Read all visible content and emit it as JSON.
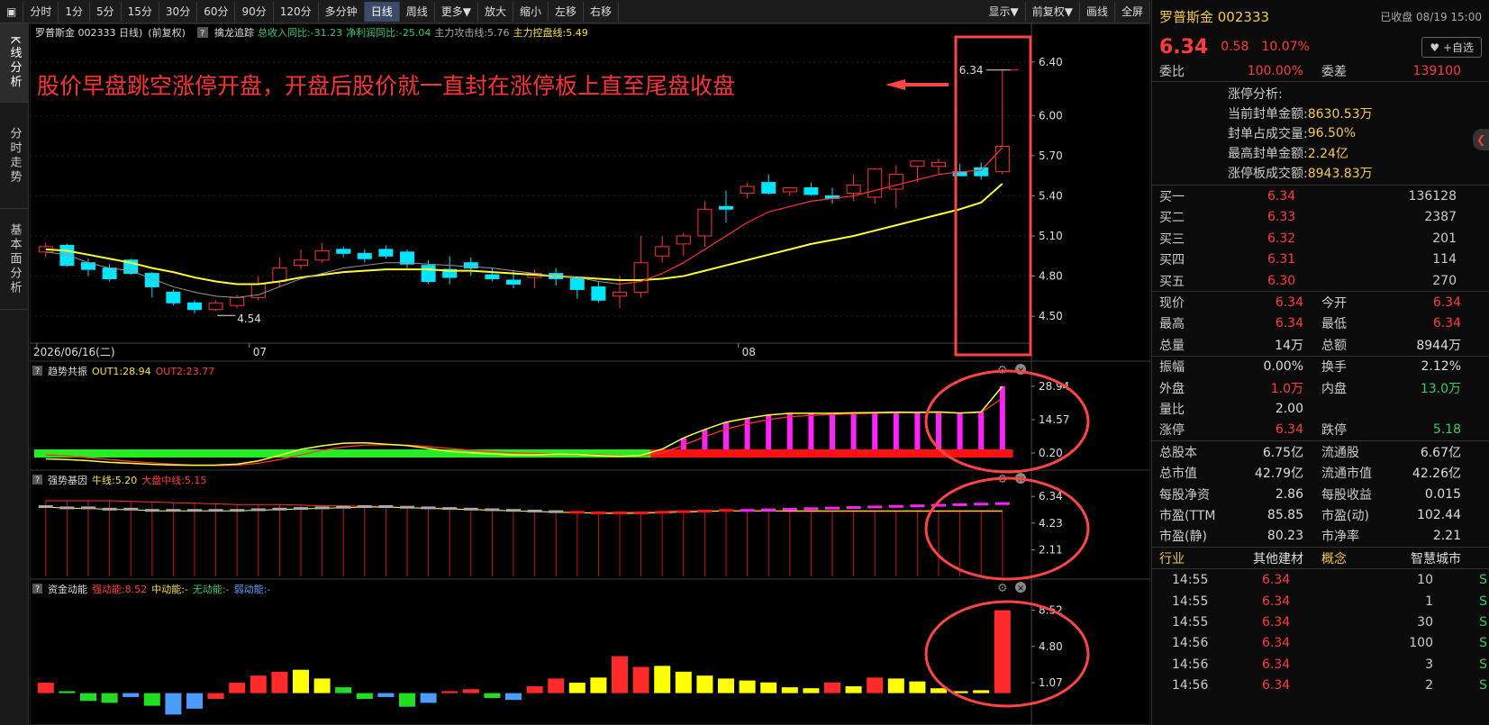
{
  "toolbar": {
    "items": [
      "分时",
      "1分",
      "5分",
      "15分",
      "30分",
      "60分",
      "90分",
      "120分",
      "多分钟",
      "日线",
      "周线",
      "更多▼",
      "放大",
      "缩小",
      "左移",
      "右移"
    ],
    "active": "日线",
    "right": [
      "显示▼",
      "前复权▼",
      "画线",
      "全屏"
    ]
  },
  "sidetabs": [
    "K线分析",
    "分时走势",
    "基本面分析"
  ],
  "chart": {
    "main": {
      "title": "罗普斯金 002333 日线)",
      "mode": "(前复权)",
      "indicator": "擒龙追踪",
      "legend": [
        {
          "text": "总收入同比:-31.23",
          "color": "#33cc66"
        },
        {
          "text": "净利润同比:-25.04",
          "color": "#33cc66"
        },
        {
          "text": "主力攻击线:5.76",
          "color": "#aaaaaa"
        },
        {
          "text": "主力控盘线:5.49",
          "color": "#f7e23c"
        }
      ],
      "yticks": [
        "6.40",
        "6.00",
        "5.70",
        "5.40",
        "5.10",
        "4.80",
        "4.50"
      ],
      "ytick_values": [
        6.4,
        6.0,
        5.7,
        5.4,
        5.1,
        4.8,
        4.5
      ],
      "ylim": [
        4.4,
        6.5
      ],
      "date_labels": [
        {
          "idx": 0,
          "text": "2026/06/16(二)"
        },
        {
          "idx": 10,
          "text": "07"
        },
        {
          "idx": 33,
          "text": "08"
        }
      ],
      "low_label": "4.54",
      "high_label": "6.34",
      "annotation": "股价早盘跳空涨停开盘，开盘后股价就一直封在涨停板上直至尾盘收盘"
    },
    "p1": {
      "name": "趋势共振",
      "legend": [
        {
          "text": "OUT1:28.94",
          "color": "#f7e23c"
        },
        {
          "text": "OUT2:23.77",
          "color": "#ff3b3b"
        }
      ],
      "yticks": [
        "28.94",
        "14.57",
        "0.20"
      ],
      "ytick_values": [
        28.94,
        14.57,
        0.2
      ],
      "ylim": [
        -6,
        32
      ]
    },
    "p2": {
      "name": "强势基因",
      "legend": [
        {
          "text": "牛线:5.20",
          "color": "#f7e23c"
        },
        {
          "text": "大盘中线:5.15",
          "color": "#ff3b3b"
        }
      ],
      "yticks": [
        "6.34",
        "4.23",
        "2.11"
      ],
      "ytick_values": [
        6.34,
        4.23,
        2.11
      ],
      "ylim": [
        0,
        7
      ]
    },
    "p3": {
      "name": "资金动能",
      "legend": [
        {
          "text": "强动能:8.52",
          "color": "#ff3b3b"
        },
        {
          "text": "中动能:-",
          "color": "#f7e23c"
        },
        {
          "text": "无动能:-",
          "color": "#33cc66"
        },
        {
          "text": "弱动能:-",
          "color": "#5aa0ff"
        }
      ],
      "yticks": [
        "8.52",
        "4.80",
        "1.07"
      ],
      "ytick_values": [
        8.52,
        4.8,
        1.07
      ],
      "ylim": [
        -3,
        9.5
      ]
    }
  },
  "chart_data": {
    "type": "candlestick",
    "count": 46,
    "open": [
      4.98,
      5.03,
      4.9,
      4.86,
      4.92,
      4.82,
      4.68,
      4.6,
      4.55,
      4.58,
      4.64,
      4.76,
      4.88,
      4.92,
      5.0,
      4.97,
      5.0,
      4.98,
      4.88,
      4.85,
      4.9,
      4.81,
      4.77,
      4.79,
      4.82,
      4.78,
      4.72,
      4.65,
      4.68,
      4.95,
      5.04,
      5.1,
      5.32,
      5.42,
      5.5,
      5.43,
      5.46,
      5.4,
      5.42,
      5.39,
      5.45,
      5.62,
      5.62,
      5.58,
      5.61,
      5.58
    ],
    "high": [
      5.05,
      5.04,
      4.93,
      4.89,
      4.93,
      4.83,
      4.7,
      4.62,
      4.62,
      4.66,
      4.8,
      4.94,
      5.0,
      5.05,
      5.02,
      5.0,
      5.03,
      5.0,
      4.92,
      4.95,
      4.94,
      4.86,
      4.84,
      4.85,
      4.86,
      4.8,
      4.76,
      4.8,
      5.1,
      5.1,
      5.12,
      5.36,
      5.44,
      5.5,
      5.56,
      5.46,
      5.5,
      5.46,
      5.56,
      5.61,
      5.63,
      5.65,
      5.68,
      5.64,
      5.65,
      6.34
    ],
    "low": [
      4.94,
      4.87,
      4.8,
      4.76,
      4.81,
      4.64,
      4.58,
      4.52,
      4.54,
      4.56,
      4.62,
      4.72,
      4.85,
      4.9,
      4.94,
      4.9,
      4.93,
      4.86,
      4.74,
      4.74,
      4.8,
      4.76,
      4.71,
      4.71,
      4.73,
      4.63,
      4.6,
      4.56,
      4.64,
      4.9,
      4.95,
      5.02,
      5.2,
      5.38,
      5.41,
      5.4,
      5.4,
      5.34,
      5.36,
      5.34,
      5.31,
      5.5,
      5.56,
      5.56,
      5.52,
      5.56
    ],
    "close": [
      5.02,
      4.88,
      4.85,
      4.78,
      4.82,
      4.72,
      4.6,
      4.55,
      4.6,
      4.64,
      4.74,
      4.86,
      4.92,
      4.99,
      4.97,
      4.93,
      4.95,
      4.89,
      4.76,
      4.79,
      4.86,
      4.78,
      4.74,
      4.82,
      4.78,
      4.7,
      4.62,
      4.68,
      4.9,
      5.02,
      5.1,
      5.3,
      5.3,
      5.47,
      5.42,
      5.46,
      5.41,
      5.38,
      5.48,
      5.6,
      5.56,
      5.66,
      5.65,
      5.55,
      5.55,
      5.77
    ],
    "ma_attack": [
      4.98,
      4.96,
      4.9,
      4.86,
      4.84,
      4.78,
      4.72,
      4.68,
      4.65,
      4.64,
      4.66,
      4.72,
      4.78,
      4.82,
      4.86,
      4.88,
      4.9,
      4.9,
      4.89,
      4.88,
      4.87,
      4.86,
      4.84,
      4.82,
      4.8,
      4.79,
      4.76,
      4.74,
      4.76,
      4.82,
      4.9,
      5.0,
      5.1,
      5.2,
      5.28,
      5.32,
      5.36,
      5.38,
      5.4,
      5.44,
      5.48,
      5.52,
      5.56,
      5.58,
      5.59,
      5.76
    ],
    "ma_control": [
      5.0,
      4.99,
      4.96,
      4.93,
      4.9,
      4.86,
      4.83,
      4.79,
      4.76,
      4.74,
      4.74,
      4.76,
      4.79,
      4.81,
      4.83,
      4.84,
      4.85,
      4.85,
      4.85,
      4.84,
      4.84,
      4.83,
      4.82,
      4.81,
      4.8,
      4.79,
      4.78,
      4.77,
      4.77,
      4.78,
      4.8,
      4.84,
      4.88,
      4.92,
      4.96,
      5.0,
      5.04,
      5.07,
      5.1,
      5.14,
      5.18,
      5.22,
      5.26,
      5.3,
      5.35,
      5.49
    ],
    "trend_out1": [
      -2.3,
      -2.6,
      -3.1,
      -3.8,
      -4.2,
      -4.7,
      -5.0,
      -5.1,
      -5.0,
      -4.6,
      -3.2,
      -0.8,
      1.8,
      3.3,
      4.4,
      4.6,
      4.0,
      3.4,
      2.2,
      0.9,
      0.3,
      -0.2,
      -0.6,
      -0.6,
      -0.3,
      -0.4,
      -0.9,
      -1.2,
      -0.8,
      1.9,
      6.7,
      10.3,
      13.5,
      15.2,
      16.6,
      17.3,
      17.3,
      17.3,
      17.5,
      17.6,
      17.8,
      17.7,
      17.9,
      17.4,
      17.9,
      28.94
    ],
    "trend_out2": [
      -0.6,
      -1.0,
      -1.8,
      -2.6,
      -3.4,
      -4.0,
      -4.6,
      -5.0,
      -5.2,
      -5.0,
      -4.2,
      -2.6,
      -0.6,
      1.4,
      2.8,
      3.6,
      3.8,
      3.6,
      3.0,
      2.2,
      1.4,
      0.8,
      0.3,
      0.0,
      -0.2,
      -0.3,
      -0.6,
      -0.9,
      -1.0,
      0.2,
      3.6,
      7.2,
      10.5,
      12.8,
      14.6,
      15.8,
      16.4,
      16.8,
      17.1,
      17.3,
      17.5,
      17.6,
      17.7,
      17.5,
      17.6,
      23.77
    ],
    "trend_state": [
      "g",
      "g",
      "g",
      "g",
      "g",
      "g",
      "g",
      "g",
      "g",
      "g",
      "g",
      "g",
      "g",
      "g",
      "g",
      "g",
      "g",
      "g",
      "g",
      "g",
      "g",
      "g",
      "g",
      "g",
      "g",
      "g",
      "g",
      "g",
      "g",
      "r",
      "r",
      "r",
      "r",
      "r",
      "r",
      "r",
      "r",
      "r",
      "r",
      "r",
      "r",
      "r",
      "r",
      "r",
      "r",
      "r"
    ],
    "gene_bull": [
      5.5,
      5.4,
      5.4,
      5.3,
      5.3,
      5.2,
      5.2,
      5.2,
      5.2,
      5.2,
      5.25,
      5.3,
      5.35,
      5.4,
      5.45,
      5.5,
      5.5,
      5.45,
      5.4,
      5.35,
      5.3,
      5.25,
      5.2,
      5.15,
      5.1,
      5.05,
      5.0,
      5.0,
      5.0,
      5.05,
      5.1,
      5.15,
      5.2,
      5.2,
      5.2,
      5.2,
      5.2,
      5.2,
      5.2,
      5.2,
      5.2,
      5.2,
      5.2,
      5.2,
      5.2,
      5.2
    ],
    "gene_mid": [
      6.0,
      6.0,
      6.0,
      6.0,
      5.95,
      5.9,
      5.85,
      5.8,
      5.75,
      5.7,
      5.7,
      5.7,
      5.65,
      5.6,
      5.6,
      5.55,
      5.5,
      5.45,
      5.4,
      5.35,
      5.3,
      5.25,
      5.2,
      5.15,
      5.1,
      5.05,
      5.05,
      5.05,
      5.1,
      5.15,
      5.2,
      5.2,
      5.2,
      5.2,
      5.2,
      5.15,
      5.15,
      5.15,
      5.15,
      5.15,
      5.15,
      5.15,
      5.15,
      5.15,
      5.15,
      5.15
    ],
    "gene_dash_color": [
      "g",
      "g",
      "g",
      "g",
      "g",
      "g",
      "g",
      "g",
      "g",
      "g",
      "g",
      "g",
      "g",
      "g",
      "g",
      "g",
      "g",
      "g",
      "g",
      "g",
      "g",
      "g",
      "g",
      "g",
      "g",
      "r",
      "r",
      "r",
      "r",
      "r",
      "r",
      "r",
      "r",
      "m",
      "m",
      "m",
      "m",
      "m",
      "m",
      "m",
      "m",
      "m",
      "m",
      "m",
      "m",
      "m"
    ],
    "energy": [
      1.07,
      0.2,
      -0.8,
      -1.0,
      -0.4,
      -1.3,
      -2.2,
      -1.6,
      -0.6,
      1.07,
      1.8,
      2.2,
      2.4,
      1.5,
      0.6,
      -0.6,
      -0.4,
      -1.4,
      -1.0,
      0.2,
      0.4,
      -0.5,
      -0.7,
      0.7,
      1.5,
      1.07,
      1.6,
      3.8,
      2.7,
      2.8,
      2.2,
      1.8,
      1.5,
      1.3,
      1.1,
      0.6,
      0.5,
      1.1,
      0.7,
      1.6,
      1.5,
      1.2,
      0.5,
      0.2,
      0.3,
      1.5,
      8.52
    ],
    "energy_color": [
      "r",
      "g",
      "g",
      "g",
      "b",
      "g",
      "b",
      "b",
      "r",
      "r",
      "r",
      "r",
      "y",
      "y",
      "g",
      "g",
      "b",
      "g",
      "b",
      "r",
      "r",
      "g",
      "b",
      "r",
      "r",
      "y",
      "y",
      "r",
      "r",
      "y",
      "y",
      "y",
      "y",
      "y",
      "y",
      "y",
      "y",
      "r",
      "y",
      "r",
      "y",
      "y",
      "y",
      "y",
      "y",
      "r",
      "r"
    ]
  },
  "panel": {
    "name": "罗普斯金 002333",
    "status": "已收盘 08/19 15:00",
    "price": "6.34",
    "change": "0.58",
    "pct": "10.07%",
    "add": "+自选",
    "weibi": {
      "label": "委比",
      "value": "100.00%",
      "label2": "委差",
      "value2": "139100"
    },
    "zt": {
      "title": "涨停分析:",
      "rows": [
        {
          "label": "当前封单金额:",
          "value": "8630.53万"
        },
        {
          "label": "封单占成交量:",
          "value": "96.50%"
        },
        {
          "label": "最高封单金额:",
          "value": "2.24亿"
        },
        {
          "label": "涨停板成交额:",
          "value": "8943.83万"
        }
      ]
    },
    "book": [
      {
        "label": "买一",
        "price": "6.34",
        "vol": "136128"
      },
      {
        "label": "买二",
        "price": "6.33",
        "vol": "2387"
      },
      {
        "label": "买三",
        "price": "6.32",
        "vol": "201"
      },
      {
        "label": "买四",
        "price": "6.31",
        "vol": "114"
      },
      {
        "label": "买五",
        "price": "6.30",
        "vol": "270"
      }
    ],
    "stats": [
      {
        "l1": "现价",
        "v1": "6.34",
        "c1": "red",
        "l2": "今开",
        "v2": "6.34",
        "c2": "red"
      },
      {
        "l1": "最高",
        "v1": "6.34",
        "c1": "red",
        "l2": "最低",
        "v2": "6.34",
        "c2": "red"
      },
      {
        "l1": "总量",
        "v1": "14万",
        "c1": "white",
        "l2": "总额",
        "v2": "8944万",
        "c2": "white"
      }
    ],
    "stats2": [
      {
        "l1": "振幅",
        "v1": "0.00%",
        "c1": "white",
        "l2": "换手",
        "v2": "2.12%",
        "c2": "white"
      },
      {
        "l1": "外盘",
        "v1": "1.0万",
        "c1": "red",
        "l2": "内盘",
        "v2": "13.0万",
        "c2": "green"
      },
      {
        "l1": "量比",
        "v1": "2.00",
        "c1": "white",
        "l2": "",
        "v2": "",
        "c2": "white"
      },
      {
        "l1": "涨停",
        "v1": "6.34",
        "c1": "red",
        "l2": "跌停",
        "v2": "5.18",
        "c2": "green"
      }
    ],
    "fund": [
      {
        "l1": "总股本",
        "v1": "6.75亿",
        "l2": "流通股",
        "v2": "6.67亿"
      },
      {
        "l1": "总市值",
        "v1": "42.79亿",
        "l2": "流通市值",
        "v2": "42.26亿"
      },
      {
        "l1": "每股净资",
        "v1": "2.86",
        "l2": "每股收益",
        "v2": "0.015"
      },
      {
        "l1": "市盈(TTM",
        "v1": "85.85",
        "l2": "市盈(动)",
        "v2": "102.44"
      },
      {
        "l1": "市盈(静)",
        "v1": "80.23",
        "l2": "市净率",
        "v2": "2.21"
      }
    ],
    "industry": {
      "l1": "行业",
      "v1": "其他建材",
      "l2": "概念",
      "v2": "智慧城市"
    },
    "ticks": [
      {
        "t": "14:55",
        "p": "6.34",
        "v": "10",
        "d": "S"
      },
      {
        "t": "14:55",
        "p": "6.34",
        "v": "1",
        "d": "S"
      },
      {
        "t": "14:55",
        "p": "6.34",
        "v": "30",
        "d": "S"
      },
      {
        "t": "14:56",
        "p": "6.34",
        "v": "100",
        "d": "S"
      },
      {
        "t": "14:56",
        "p": "6.34",
        "v": "3",
        "d": "S"
      },
      {
        "t": "14:56",
        "p": "6.34",
        "v": "2",
        "d": "S"
      }
    ]
  }
}
